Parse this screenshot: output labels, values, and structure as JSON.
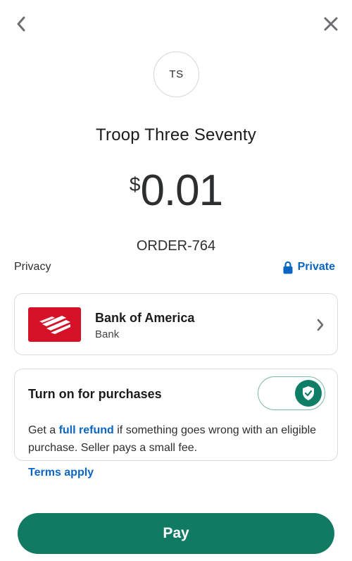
{
  "nav": {
    "back_icon": "chevron-left-icon",
    "close_icon": "close-icon"
  },
  "recipient": {
    "initials": "TS",
    "name": "Troop Three Seventy"
  },
  "payment": {
    "currency_symbol": "$",
    "amount": "0.01",
    "note": "ORDER-764"
  },
  "privacy": {
    "label": "Privacy",
    "value": "Private",
    "icon": "lock-icon"
  },
  "funding": {
    "bank_name": "Bank of America",
    "account_type": "Bank",
    "logo_color": "#d41127"
  },
  "protection": {
    "title": "Turn on for purchases",
    "toggle_on": true,
    "desc_prefix": "Get a ",
    "desc_link": "full refund",
    "desc_suffix": " if something goes wrong with an eligible purchase. Seller pays a small fee."
  },
  "terms_label": "Terms apply",
  "pay_label": "Pay",
  "colors": {
    "accent_green": "#117a63",
    "link_blue": "#0a66c2"
  }
}
